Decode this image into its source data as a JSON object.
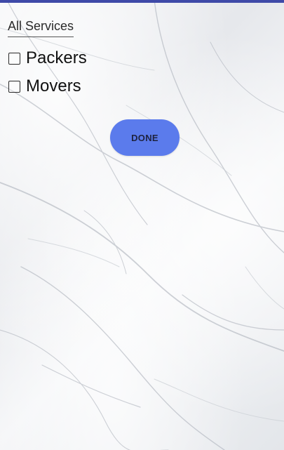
{
  "theme": {
    "top_border_color": "#3f4aa8",
    "button_color": "#5b7bec",
    "background": "white marble texture"
  },
  "services": {
    "title": "All Services",
    "options": [
      {
        "label": "Packers",
        "checked": false,
        "icon": "checkbox-icon"
      },
      {
        "label": "Movers",
        "checked": false,
        "icon": "checkbox-icon"
      }
    ]
  },
  "actions": {
    "done_label": "DONE"
  }
}
